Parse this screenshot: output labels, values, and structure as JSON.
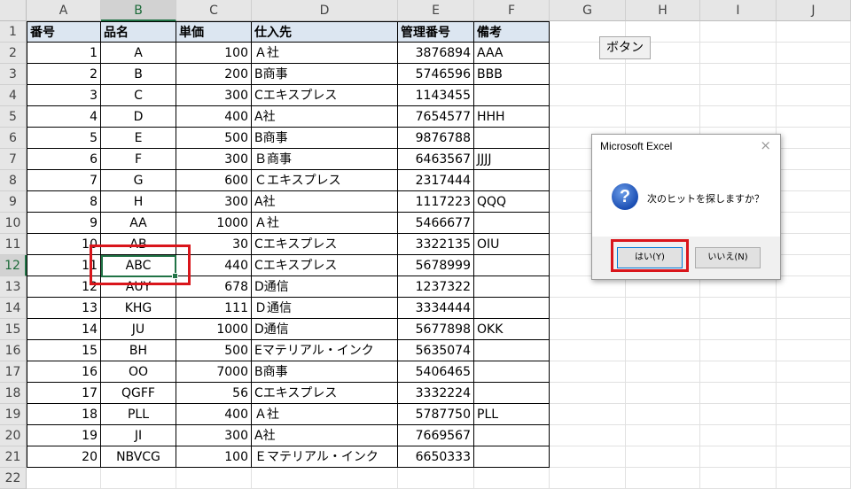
{
  "sheet": {
    "columns": [
      "A",
      "B",
      "C",
      "D",
      "E",
      "F",
      "G",
      "H",
      "I",
      "J"
    ],
    "rows": [
      "1",
      "2",
      "3",
      "4",
      "5",
      "6",
      "7",
      "8",
      "9",
      "10",
      "11",
      "12",
      "13",
      "14",
      "15",
      "16",
      "17",
      "18",
      "19",
      "20",
      "21",
      "22"
    ],
    "active_column": "B",
    "active_row": "12",
    "table_header": [
      "番号",
      "品名",
      "単価",
      "仕入先",
      "管理番号",
      "備考"
    ],
    "table_rows": [
      [
        "1",
        "A",
        "100",
        "Ａ社",
        "3876894",
        "AAA"
      ],
      [
        "2",
        "B",
        "200",
        "B商事",
        "5746596",
        "BBB"
      ],
      [
        "3",
        "C",
        "300",
        "Cエキスプレス",
        "1143455",
        ""
      ],
      [
        "4",
        "D",
        "400",
        "A社",
        "7654577",
        "HHH"
      ],
      [
        "5",
        "E",
        "500",
        "B商事",
        "9876788",
        ""
      ],
      [
        "6",
        "F",
        "300",
        "Ｂ商事",
        "6463567",
        "JJJJ"
      ],
      [
        "7",
        "G",
        "600",
        "Ｃエキスプレス",
        "2317444",
        ""
      ],
      [
        "8",
        "H",
        "300",
        "A社",
        "1117223",
        "QQQ"
      ],
      [
        "9",
        "AA",
        "1000",
        "Ａ社",
        "5466677",
        ""
      ],
      [
        "10",
        "AB",
        "30",
        "Cエキスプレス",
        "3322135",
        "OIU"
      ],
      [
        "11",
        "ABC",
        "440",
        "Cエキスプレス",
        "5678999",
        ""
      ],
      [
        "12",
        "AUY",
        "678",
        "D通信",
        "1237322",
        ""
      ],
      [
        "13",
        "KHG",
        "111",
        "Ｄ通信",
        "3334444",
        ""
      ],
      [
        "14",
        "JU",
        "1000",
        "D通信",
        "5677898",
        "OKK"
      ],
      [
        "15",
        "BH",
        "500",
        "Eマテリアル・インク",
        "5635074",
        ""
      ],
      [
        "16",
        "OO",
        "7000",
        "B商事",
        "5406465",
        ""
      ],
      [
        "17",
        "QGFF",
        "56",
        "Cエキスプレス",
        "3332224",
        ""
      ],
      [
        "18",
        "PLL",
        "400",
        "Ａ社",
        "5787750",
        "PLL"
      ],
      [
        "19",
        "JI",
        "300",
        "A社",
        "7669567",
        ""
      ],
      [
        "20",
        "NBVCG",
        "100",
        "Ｅマテリアル・インク",
        "6650333",
        ""
      ]
    ],
    "button_label": "ボタン"
  },
  "dialog": {
    "title": "Microsoft Excel",
    "close_glyph": "×",
    "icon_glyph": "?",
    "message": "次のヒットを探しますか？",
    "yes_label": "はい(Y)",
    "no_label": "いいえ(N)"
  },
  "colors": {
    "highlight_red": "#d9151b",
    "selection_green": "#217346",
    "header_fill": "#dce6f1"
  }
}
